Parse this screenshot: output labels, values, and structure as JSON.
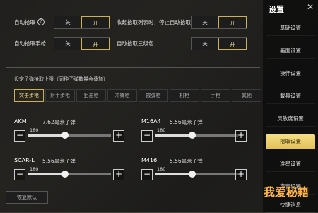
{
  "top": {
    "auto_pickup": "自动拾取",
    "auto_pickup_help": "?",
    "auto_pickup_pistol": "自动拾取手枪",
    "collapse_stop_pickup": "收起拾取列表时，停止自动拾取",
    "auto_pickup_lvl3_bag": "自动拾取三级包",
    "off": "关",
    "on": "开"
  },
  "limit_title": "设定子弹拾取上限（同种子弹数量会叠加）",
  "tabs": [
    "突击步枪",
    "射手步枪",
    "狙击枪",
    "冲锋枪",
    "霰弹枪",
    "机枪",
    "手枪",
    "其他"
  ],
  "guns": [
    {
      "name": "AKM",
      "desc": "7.62毫米子弹",
      "value": "180",
      "fraction": 0.45
    },
    {
      "name": "M16A4",
      "desc": "5.56毫米子弹",
      "value": "180",
      "fraction": 0.45
    },
    {
      "name": "SCAR-L",
      "desc": "5.56毫米子弹",
      "value": "180",
      "fraction": 0.45
    },
    {
      "name": "M416",
      "desc": "5.56毫米子弹",
      "value": "180",
      "fraction": 0.45
    }
  ],
  "reset": "恢复默认",
  "sidebar": {
    "title": "设置",
    "close": "✕",
    "items": [
      "基础设置",
      "画面设置",
      "操作设置",
      "载具设置",
      "灵敏度设置",
      "拾取设置",
      "准星设置",
      "声音设置",
      "快捷消息"
    ]
  },
  "watermark": "我爱秘籍",
  "colors": {
    "accent": "#e4c25a"
  }
}
